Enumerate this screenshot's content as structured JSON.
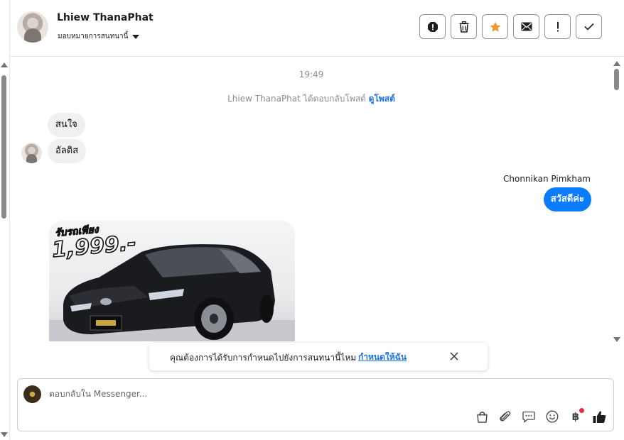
{
  "header": {
    "contact_name": "Lhiew ThanaPhat",
    "assign_label": "มอบหมายการสนทนานี้"
  },
  "actions": [
    "spam-icon",
    "trash-icon",
    "star-icon",
    "mail-icon",
    "exclamation-icon",
    "check-icon"
  ],
  "colors": {
    "accent": "#0a7cff",
    "link": "#1b74e4",
    "star": "#f5962b"
  },
  "messages": {
    "time": "19:49",
    "system_prefix": "Lhiew ThanaPhat ได้ตอบกลับโพสต์",
    "system_link": "ดูโพสต์",
    "incoming_1": "สนใจ",
    "incoming_2": "อัลติส",
    "outgoing_sender": "Chonnikan Pimkham",
    "outgoing_1": "สวัสดีค่ะ",
    "promo_line1": "รับรถเพียง",
    "promo_price": "1,999.-"
  },
  "toast": {
    "text": "คุณต้องการได้รับการกำหนดไปยังการสนทนานี้ไหม",
    "link": "กำหนดให้ฉัน"
  },
  "composer": {
    "placeholder": "ตอบกลับใน Messenger...",
    "baht_symbol": "฿"
  }
}
